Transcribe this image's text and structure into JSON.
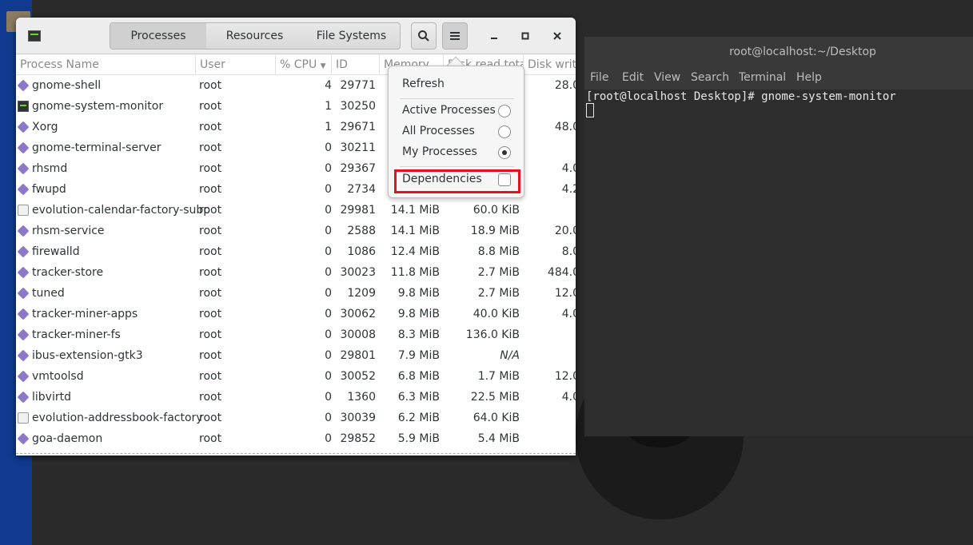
{
  "app": {
    "tabs": [
      "Processes",
      "Resources",
      "File Systems"
    ]
  },
  "columns": [
    "Process Name",
    "User",
    "% CPU",
    "ID",
    "Memory",
    "Disk read tota",
    "Disk writ"
  ],
  "processes": [
    {
      "name": "gnome-shell",
      "user": "root",
      "cpu": "4",
      "id": "29771",
      "memory": "",
      "read": "",
      "write": "28.0",
      "icon": "gear-icon"
    },
    {
      "name": "gnome-system-monitor",
      "user": "root",
      "cpu": "1",
      "id": "30250",
      "memory": "",
      "read": "",
      "write": "",
      "icon": "monitor-icon"
    },
    {
      "name": "Xorg",
      "user": "root",
      "cpu": "1",
      "id": "29671",
      "memory": "",
      "read": "",
      "write": "48.0",
      "icon": "gear-icon"
    },
    {
      "name": "gnome-terminal-server",
      "user": "root",
      "cpu": "0",
      "id": "30211",
      "memory": "",
      "read": "",
      "write": "",
      "icon": "gear-icon"
    },
    {
      "name": "rhsmd",
      "user": "root",
      "cpu": "0",
      "id": "29367",
      "memory": "",
      "read": "",
      "write": "4.0",
      "icon": "gear-icon"
    },
    {
      "name": "fwupd",
      "user": "root",
      "cpu": "0",
      "id": "2734",
      "memory": "",
      "read": "",
      "write": "4.2",
      "icon": "gear-icon"
    },
    {
      "name": "evolution-calendar-factory-subp",
      "user": "root",
      "cpu": "0",
      "id": "29981",
      "memory": "14.1 MiB",
      "read": "60.0 KiB",
      "write": "",
      "icon": "mail-icon"
    },
    {
      "name": "rhsm-service",
      "user": "root",
      "cpu": "0",
      "id": "2588",
      "memory": "14.1 MiB",
      "read": "18.9 MiB",
      "write": "20.0",
      "icon": "gear-icon"
    },
    {
      "name": "firewalld",
      "user": "root",
      "cpu": "0",
      "id": "1086",
      "memory": "12.4 MiB",
      "read": "8.8 MiB",
      "write": "8.0",
      "icon": "gear-icon"
    },
    {
      "name": "tracker-store",
      "user": "root",
      "cpu": "0",
      "id": "30023",
      "memory": "11.8 MiB",
      "read": "2.7 MiB",
      "write": "484.0",
      "icon": "gear-icon"
    },
    {
      "name": "tuned",
      "user": "root",
      "cpu": "0",
      "id": "1209",
      "memory": "9.8 MiB",
      "read": "2.7 MiB",
      "write": "12.0",
      "icon": "gear-icon"
    },
    {
      "name": "tracker-miner-apps",
      "user": "root",
      "cpu": "0",
      "id": "30062",
      "memory": "9.8 MiB",
      "read": "40.0 KiB",
      "write": "4.0",
      "icon": "gear-icon"
    },
    {
      "name": "tracker-miner-fs",
      "user": "root",
      "cpu": "0",
      "id": "30008",
      "memory": "8.3 MiB",
      "read": "136.0 KiB",
      "write": "",
      "icon": "gear-icon"
    },
    {
      "name": "ibus-extension-gtk3",
      "user": "root",
      "cpu": "0",
      "id": "29801",
      "memory": "7.9 MiB",
      "read": "N/A",
      "write": "",
      "icon": "gear-icon"
    },
    {
      "name": "vmtoolsd",
      "user": "root",
      "cpu": "0",
      "id": "30052",
      "memory": "6.8 MiB",
      "read": "1.7 MiB",
      "write": "12.0",
      "icon": "gear-icon"
    },
    {
      "name": "libvirtd",
      "user": "root",
      "cpu": "0",
      "id": "1360",
      "memory": "6.3 MiB",
      "read": "22.5 MiB",
      "write": "4.0",
      "icon": "gear-icon"
    },
    {
      "name": "evolution-addressbook-factory",
      "user": "root",
      "cpu": "0",
      "id": "30039",
      "memory": "6.2 MiB",
      "read": "64.0 KiB",
      "write": "",
      "icon": "mail-icon"
    },
    {
      "name": "goa-daemon",
      "user": "root",
      "cpu": "0",
      "id": "29852",
      "memory": "5.9 MiB",
      "read": "5.4 MiB",
      "write": "",
      "icon": "gear-icon"
    }
  ],
  "menu": {
    "refresh": "Refresh",
    "active": "Active Processes",
    "all": "All Processes",
    "my": "My Processes",
    "dependencies": "Dependencies",
    "selected_filter": "My Processes",
    "dependencies_checked": false
  },
  "terminal": {
    "title": "root@localhost:~/Desktop",
    "menus": [
      "File",
      "Edit",
      "View",
      "Search",
      "Terminal",
      "Help"
    ],
    "line1": "[root@localhost Desktop]# gnome-system-monitor"
  },
  "colors": {
    "highlight": "#e0141e",
    "process_icon": "#8d77c9",
    "desktop_strip": "#0f3a8f"
  }
}
